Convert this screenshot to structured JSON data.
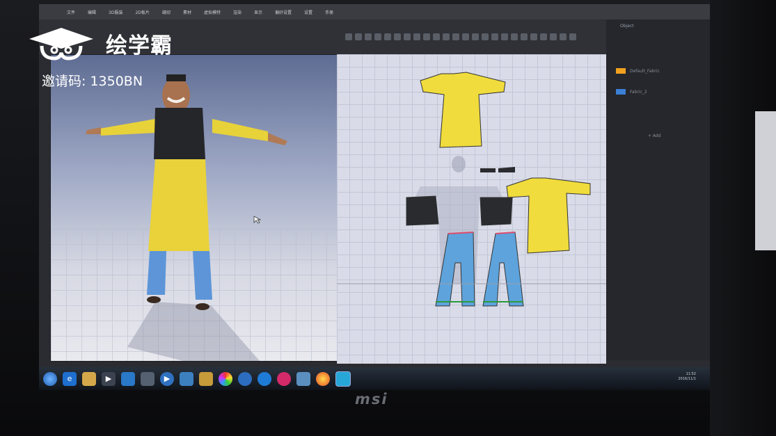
{
  "watermark": {
    "brand": "绘学霸",
    "invite_text": "邀请码: 1350BN"
  },
  "menu": {
    "items": [
      "文件",
      "编辑",
      "3D服装",
      "2D板片",
      "缝纫",
      "素材",
      "虚拟模特",
      "渲染",
      "显示",
      "偏好设置",
      "设置",
      "手册"
    ]
  },
  "side_panel": {
    "tab_label": "Object",
    "objects": [
      {
        "name": "Default_Fabric",
        "color": "#f2a020"
      },
      {
        "name": "Fabric_2",
        "color": "#3b7fd6"
      }
    ],
    "button_label": "+ Add"
  },
  "taskbar": {
    "apps": [
      "start-orb",
      "ie-icon",
      "folder-icon",
      "media-icon",
      "app-icon",
      "app-icon",
      "player-icon",
      "app-icon",
      "app-icon",
      "color-icon",
      "app-icon",
      "app-icon",
      "app-icon",
      "app-icon",
      "chrome-icon",
      "clo-icon"
    ],
    "time": "11:52",
    "date": "2016/11/1"
  },
  "monitor": {
    "brand": "msi"
  }
}
